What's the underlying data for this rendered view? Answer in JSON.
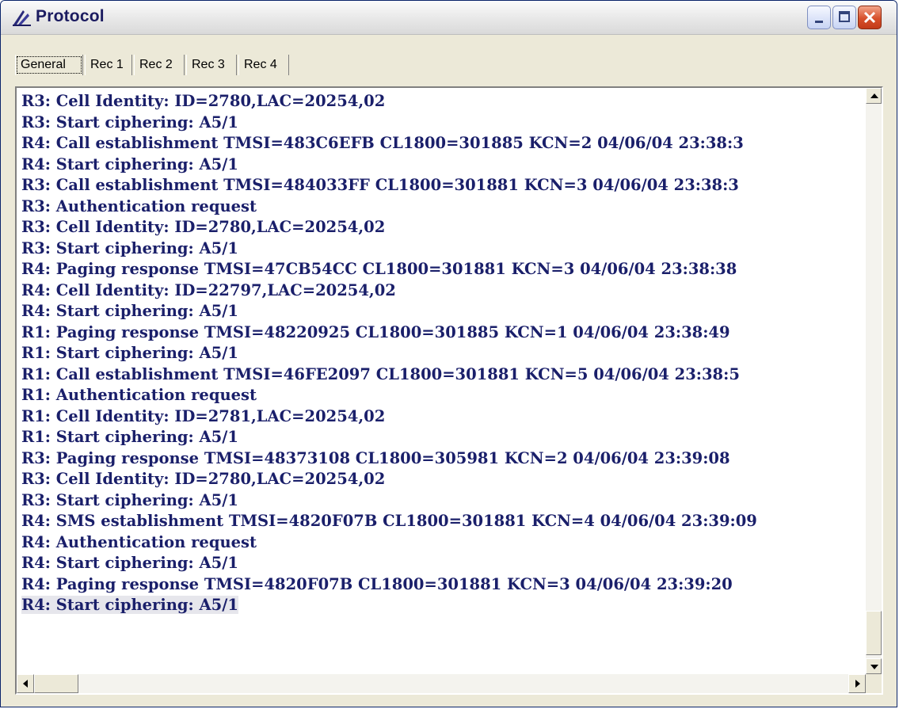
{
  "window": {
    "title": "Protocol"
  },
  "tabs": [
    {
      "label": "General",
      "active": true
    },
    {
      "label": "Rec 1",
      "active": false
    },
    {
      "label": "Rec 2",
      "active": false
    },
    {
      "label": "Rec 3",
      "active": false
    },
    {
      "label": "Rec 4",
      "active": false
    }
  ],
  "log": [
    "R3: Cell Identity: ID=2780,LAC=20254,02",
    "R3: Start ciphering: A5/1",
    "R4: Call establishment TMSI=483C6EFB CL1800=301885 KCN=2 04/06/04 23:38:3",
    "R4: Start ciphering: A5/1",
    "R3: Call establishment TMSI=484033FF CL1800=301881 KCN=3 04/06/04 23:38:3",
    "R3: Authentication request",
    "R3: Cell Identity: ID=2780,LAC=20254,02",
    "R3: Start ciphering: A5/1",
    "R4: Paging response TMSI=47CB54CC CL1800=301881 KCN=3 04/06/04 23:38:38",
    "R4: Cell Identity: ID=22797,LAC=20254,02",
    "R4: Start ciphering: A5/1",
    "R1: Paging response TMSI=48220925 CL1800=301885 KCN=1 04/06/04 23:38:49",
    "R1: Start ciphering: A5/1",
    "R1: Call establishment TMSI=46FE2097 CL1800=301881 KCN=5 04/06/04 23:38:5",
    "R1: Authentication request",
    "R1: Cell Identity: ID=2781,LAC=20254,02",
    "R1: Start ciphering: A5/1",
    "R3: Paging response TMSI=48373108 CL1800=305981 KCN=2 04/06/04 23:39:08",
    "R3: Cell Identity: ID=2780,LAC=20254,02",
    "R3: Start ciphering: A5/1",
    "R4: SMS establishment TMSI=4820F07B CL1800=301881 KCN=4 04/06/04 23:39:09",
    "R4: Authentication request",
    "R4: Start ciphering: A5/1",
    "R4: Paging response TMSI=4820F07B CL1800=301881 KCN=3 04/06/04 23:39:20",
    "R4: Start ciphering: A5/1"
  ],
  "selected_line": 24,
  "colors": {
    "log_text": "#1a1f6a",
    "title_text": "#1b1b60",
    "close_button": "#d7502b"
  },
  "icons": {
    "app": "protocol-antenna-icon",
    "minimize": "minimize-icon",
    "maximize": "maximize-icon",
    "close": "close-icon"
  }
}
